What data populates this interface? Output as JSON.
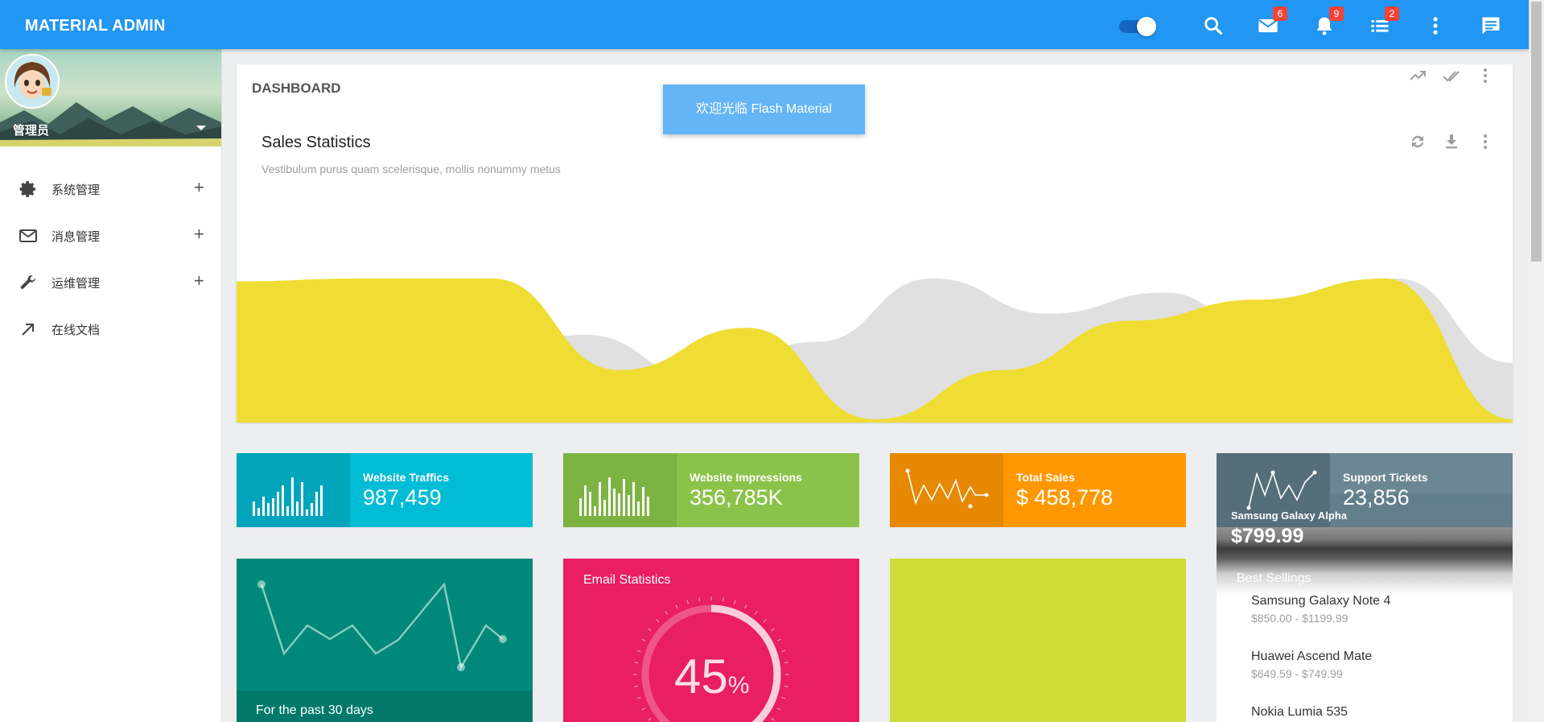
{
  "header": {
    "brand": "MATERIAL ADMIN",
    "icons": [
      {
        "name": "search-icon"
      },
      {
        "name": "mail-icon",
        "badge": "6"
      },
      {
        "name": "bell-icon",
        "badge": "9"
      },
      {
        "name": "list-icon",
        "badge": "2"
      },
      {
        "name": "more-vert-icon"
      },
      {
        "name": "chat-icon"
      }
    ],
    "color": "#2196f3"
  },
  "sidebar": {
    "profile_name": "管理员",
    "items": [
      {
        "label": "系统管理",
        "icon": "gear-icon",
        "expandable": true
      },
      {
        "label": "消息管理",
        "icon": "mail-outline-icon",
        "expandable": true
      },
      {
        "label": "运维管理",
        "icon": "wrench-icon",
        "expandable": true
      },
      {
        "label": "在线文档",
        "icon": "arrow-up-right-icon",
        "expandable": false
      }
    ],
    "plus": "+"
  },
  "dashboard": {
    "title": "DASHBOARD",
    "sales_title": "Sales Statistics",
    "sales_subtitle": "Vestibulum purus quam scelerisque, mollis nonummy metus"
  },
  "toast": "欢迎光临 Flash Material",
  "chart_data": {
    "type": "area",
    "series": [
      {
        "values": [
          0,
          0,
          0.45,
          0.6,
          0.3,
          0.55,
          1.0,
          0.75,
          0.9,
          0.5,
          1.0,
          0.4
        ],
        "color": "#e0e0e0"
      },
      {
        "values": [
          0.98,
          1.0,
          1.0,
          0.35,
          0.65,
          0.0,
          0.35,
          0.7,
          0.85,
          1.0,
          0.0
        ],
        "color": "#efdd34"
      }
    ]
  },
  "tiles": [
    {
      "label": "Website Traffics",
      "value": "987,459",
      "color": "#00bcd4",
      "spark_color": "#00a5bb"
    },
    {
      "label": "Website Impressions",
      "value": "356,785K",
      "color": "#8bc34a",
      "spark_color": "#7cb342"
    },
    {
      "label": "Total Sales",
      "value": "$ 458,778",
      "color": "#ff9800",
      "spark_color": "#e68900"
    }
  ],
  "support": {
    "label": "Support Tickets",
    "value": "23,856"
  },
  "teal_card": {
    "footer": "For the past 30 days"
  },
  "email_card": {
    "title": "Email Statistics",
    "percent": "45",
    "percent_sign": "%",
    "progress": 0.45
  },
  "best_sellings": {
    "hero_name": "Samsung Galaxy Alpha",
    "hero_price": "$799.99",
    "title": "Best Sellings",
    "products": [
      {
        "name": "Samsung Galaxy Note 4",
        "price": "$850.00 - $1199.99"
      },
      {
        "name": "Huawei Ascend Mate",
        "price": "$649.59 - $749.99"
      },
      {
        "name": "Nokia Lumia 535",
        "price": ""
      }
    ]
  }
}
